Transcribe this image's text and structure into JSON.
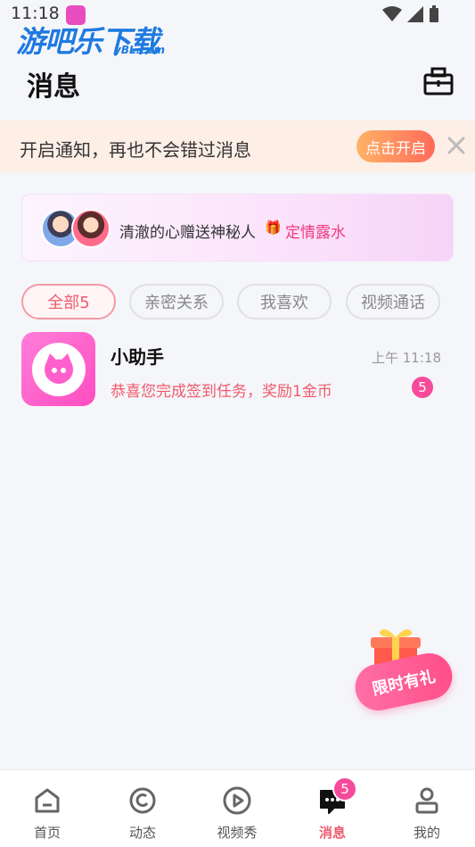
{
  "status_bar": {
    "time": "11:18"
  },
  "watermark": {
    "text": "游吧乐下载",
    "sub": "yBL.com"
  },
  "header": {
    "title": "消息"
  },
  "notice": {
    "text": "开启通知，再也不会错过消息",
    "button": "点击开启"
  },
  "banner": {
    "text": "清澈的心赠送神秘人",
    "gift_emoji": "🎁",
    "highlight": "定情露水"
  },
  "tabs": [
    {
      "label": "全部5",
      "active": true
    },
    {
      "label": "亲密关系",
      "active": false
    },
    {
      "label": "我喜欢",
      "active": false
    },
    {
      "label": "视频通话",
      "active": false
    }
  ],
  "messages": [
    {
      "name": "小助手",
      "time": "上午 11:18",
      "preview": "恭喜您完成签到任务，奖励1金币",
      "unread": "5"
    }
  ],
  "promo": {
    "label": "限时有礼"
  },
  "nav": {
    "items": [
      {
        "label": "首页"
      },
      {
        "label": "动态"
      },
      {
        "label": "视频秀"
      },
      {
        "label": "消息"
      },
      {
        "label": "我的"
      }
    ],
    "message_badge": "5"
  },
  "colors": {
    "accent": "#f05a6c",
    "badge": "#f64a9b",
    "notice_bg": "#fdeee6"
  }
}
